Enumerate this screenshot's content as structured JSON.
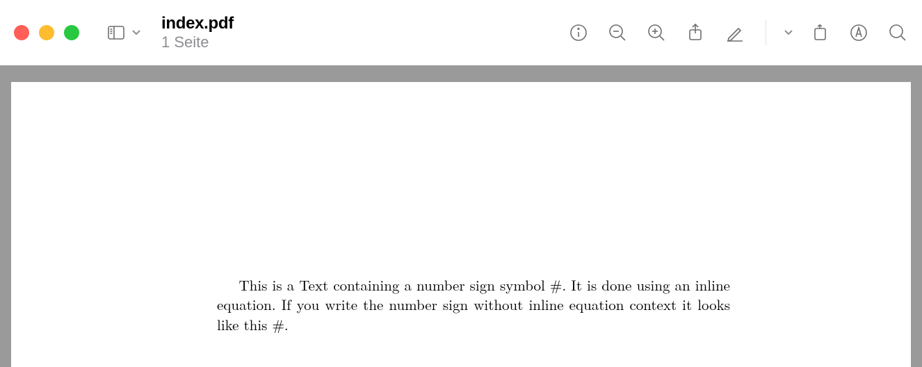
{
  "window": {
    "title": "index.pdf",
    "subtitle": "1 Seite"
  },
  "document": {
    "body_text": "This is a Text containing a number sign symbol #. It is done using an inline equation. If you write the number sign without inline equation context it looks like this #."
  },
  "icons": {
    "sidebar": "sidebar-icon",
    "info": "info-icon",
    "zoom_out": "zoom-out-icon",
    "zoom_in": "zoom-in-icon",
    "share": "share-icon",
    "markup": "markup-icon",
    "rotate": "rotate-icon",
    "highlight": "highlight-icon",
    "search": "search-icon"
  }
}
